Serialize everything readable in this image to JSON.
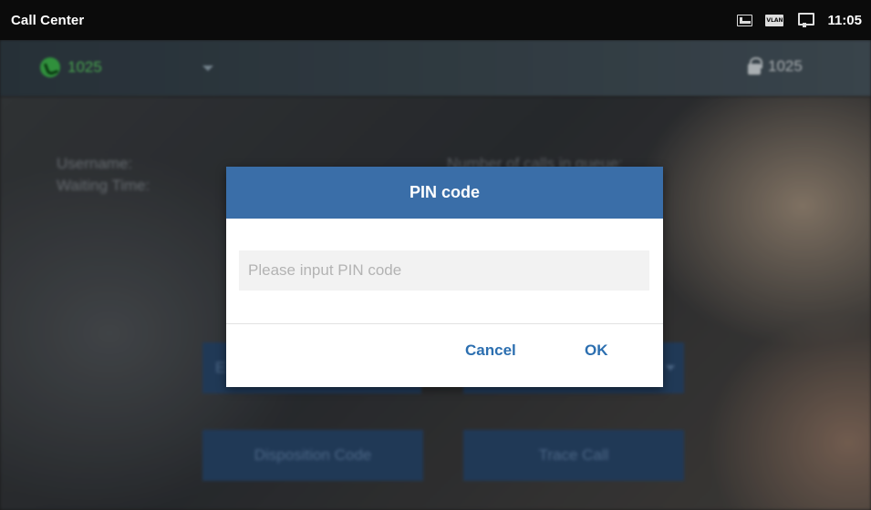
{
  "status_bar": {
    "title": "Call Center",
    "vlan_label": "VLAN",
    "time": "11:05"
  },
  "account_bar": {
    "account_number": "1025",
    "locked_number": "1025"
  },
  "background": {
    "username_label": "Username:",
    "waiting_time_label": "Waiting Time:",
    "calls_in_queue_label": "Number of calls in queue:",
    "left_top_button_partial": "E",
    "disposition_code_label": "Disposition Code",
    "trace_call_label": "Trace Call"
  },
  "dialog": {
    "title": "PIN code",
    "pin_placeholder": "Please input PIN code",
    "pin_value": "",
    "cancel_label": "Cancel",
    "ok_label": "OK"
  },
  "colors": {
    "dialog_header": "#3a6ea8",
    "dialog_button_text": "#2c6fb0",
    "account_green": "#58c860"
  }
}
